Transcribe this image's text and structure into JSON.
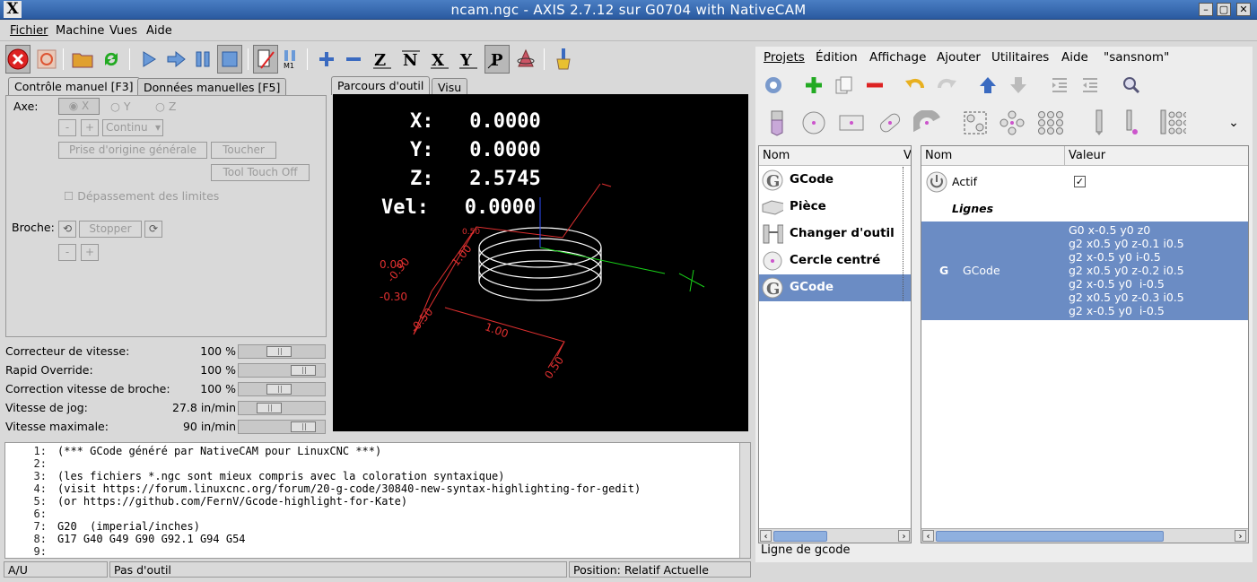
{
  "window": {
    "title": "ncam.ngc - AXIS 2.7.12 sur G0704 with NativeCAM"
  },
  "menu": [
    "Fichier",
    "Machine",
    "Vues",
    "Aide"
  ],
  "tabs_left": {
    "manual": "Contrôle manuel [F3]",
    "mdi": "Données manuelles [F5]"
  },
  "manual": {
    "axe_label": "Axe:",
    "axes": [
      "X",
      "Y",
      "Z"
    ],
    "minus": "-",
    "plus": "+",
    "jog_mode": "Continu",
    "home_button": "Prise d'origine générale",
    "touch_button": "Toucher",
    "tool_touch_button": "Tool Touch Off",
    "limits_label": "Dépassement des limites",
    "spindle_label": "Broche:",
    "stop_button": "Stopper"
  },
  "overrides": [
    {
      "label": "Correcteur de vitesse:",
      "value": "100 %",
      "level": 0.45
    },
    {
      "label": "Rapid Override:",
      "value": "100 %",
      "level": 0.85
    },
    {
      "label": "Correction vitesse de broche:",
      "value": "100 %",
      "level": 0.45
    },
    {
      "label": "Vitesse de jog:",
      "value": "27.8 in/min",
      "level": 0.3
    },
    {
      "label": "Vitesse maximale:",
      "value": "90 in/min",
      "level": 0.85
    }
  ],
  "preview_tabs": {
    "toolpath": "Parcours d'outil",
    "visu": "Visu"
  },
  "dro": [
    {
      "label": "X:",
      "value": "0.0000"
    },
    {
      "label": "Y:",
      "value": "0.0000"
    },
    {
      "label": "Z:",
      "value": "2.5745"
    },
    {
      "label": "Vel:",
      "value": "0.0000"
    }
  ],
  "preview_labels": {
    "d1": "0.00",
    "d2": "-0.30",
    "d3": "-0.30",
    "d4": "-0.50",
    "d5": "1.00",
    "d6": "0.50",
    "d7": "1.00",
    "d8": "0.50"
  },
  "code": [
    {
      "n": "1:",
      "t": "(*** GCode généré par NativeCAM pour LinuxCNC ***)"
    },
    {
      "n": "2:",
      "t": ""
    },
    {
      "n": "3:",
      "t": "(les fichiers *.ngc sont mieux compris avec la coloration syntaxique)"
    },
    {
      "n": "4:",
      "t": "(visit https://forum.linuxcnc.org/forum/20-g-code/30840-new-syntax-highlighting-for-gedit)"
    },
    {
      "n": "5:",
      "t": "(or https://github.com/FernV/Gcode-highlight-for-Kate)"
    },
    {
      "n": "6:",
      "t": ""
    },
    {
      "n": "7:",
      "t": "G20  (imperial/inches)"
    },
    {
      "n": "8:",
      "t": "G17 G40 G49 G90 G92.1 G94 G54"
    },
    {
      "n": "9:",
      "t": ""
    }
  ],
  "status": {
    "state": "A/U",
    "tool": "Pas d'outil",
    "position": "Position: Relatif Actuelle"
  },
  "ncam_menu": [
    "Projets",
    "Édition",
    "Affichage",
    "Ajouter",
    "Utilitaires",
    "Aide",
    "\"sansnom\""
  ],
  "tree": {
    "col_name": "Nom",
    "col_v": "V",
    "items": [
      "GCode",
      "Pièce",
      "Changer d'outil",
      "Cercle centré",
      "GCode"
    ]
  },
  "props": {
    "col_name": "Nom",
    "col_value": "Valeur",
    "actif": "Actif",
    "check": "✓",
    "lignes": "Lignes",
    "gcode_name": "GCode",
    "gcode_lines": [
      "G0 x-0.5 y0 z0",
      "g2 x0.5 y0 z-0.1 i0.5",
      "g2 x-0.5 y0 i-0.5",
      "g2 x0.5 y0 z-0.2 i0.5",
      "g2 x-0.5 y0  i-0.5",
      "g2 x0.5 y0 z-0.3 i0.5",
      "g2 x-0.5 y0  i-0.5"
    ]
  },
  "bottom_label": "Ligne de gcode",
  "icons": [
    "estop-icon",
    "power-icon",
    "open-icon",
    "reload-icon",
    "run-icon",
    "step-icon",
    "pause-icon",
    "stop-icon",
    "block-delete-icon",
    "optional-stop-icon",
    "zoom-in-icon",
    "zoom-out-icon",
    "view-z-icon",
    "view-z2-icon",
    "view-x-icon",
    "view-y-icon",
    "view-p-icon",
    "rotate-icon",
    "clear-icon"
  ],
  "colors": {
    "selection": "#6b8cc4",
    "toolpath": "#ffffff",
    "limits": "#ff3b3b",
    "axis_x": "#00ff00"
  }
}
